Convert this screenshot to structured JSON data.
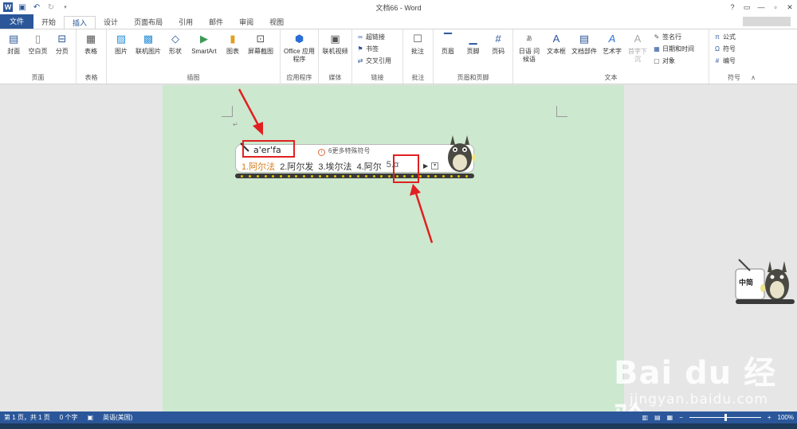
{
  "titlebar": {
    "title": "文档66 - Word",
    "help": "?",
    "minimize": "—",
    "restore": "▫",
    "close": "✕"
  },
  "tabs": [
    {
      "label": "文件",
      "kind": "file"
    },
    {
      "label": "开始"
    },
    {
      "label": "插入",
      "active": true
    },
    {
      "label": "设计"
    },
    {
      "label": "页面布局"
    },
    {
      "label": "引用"
    },
    {
      "label": "邮件"
    },
    {
      "label": "审阅"
    },
    {
      "label": "视图"
    }
  ],
  "ribbon": {
    "pages": {
      "label": "页面",
      "buttons": [
        "封面",
        "空白页",
        "分页"
      ]
    },
    "tables": {
      "label": "表格",
      "buttons": [
        "表格"
      ]
    },
    "illustrations": {
      "label": "插图",
      "buttons": [
        "图片",
        "联机图片",
        "形状",
        "SmartArt",
        "图表",
        "屏幕截图"
      ]
    },
    "apps": {
      "label": "应用程序",
      "buttons": [
        "Office 应用程序"
      ]
    },
    "media": {
      "label": "媒体",
      "buttons": [
        "联机视频"
      ]
    },
    "links": {
      "label": "链接",
      "buttons": [
        "超链接",
        "书签",
        "交叉引用"
      ]
    },
    "comments": {
      "label": "批注",
      "buttons": [
        "批注"
      ]
    },
    "header_footer": {
      "label": "页眉和页脚",
      "buttons": [
        "页眉",
        "页脚",
        "页码"
      ]
    },
    "text": {
      "label": "文本",
      "buttons": [
        "日语 问候语",
        "文本框",
        "文档部件",
        "艺术字",
        "首字下沉"
      ],
      "small": [
        "签名行",
        "日期和时间",
        "对象"
      ]
    },
    "symbols": {
      "label": "符号",
      "small": [
        "公式",
        "符号",
        "编号"
      ]
    }
  },
  "ime": {
    "pinyin": "a'er'fa",
    "hint": "6更多特殊符号",
    "candidates": [
      "1.阿尔法",
      "2.阿尔发",
      "3.埃尔法",
      "4.阿尔",
      "5.α"
    ],
    "status_label": "中简"
  },
  "statusbar": {
    "page": "第 1 页，共 1 页",
    "words": "0 个字",
    "language": "英语(美国)",
    "zoom": "100%",
    "zoom_minus": "−",
    "zoom_plus": "+"
  },
  "watermark": {
    "logo": "Bai du 经验",
    "url": "jingyan.baidu.com"
  },
  "colors": {
    "accent": "#2b579a",
    "page": "#cce8cf",
    "annotation": "#e02020",
    "candidate_highlight": "#d47c1a"
  }
}
